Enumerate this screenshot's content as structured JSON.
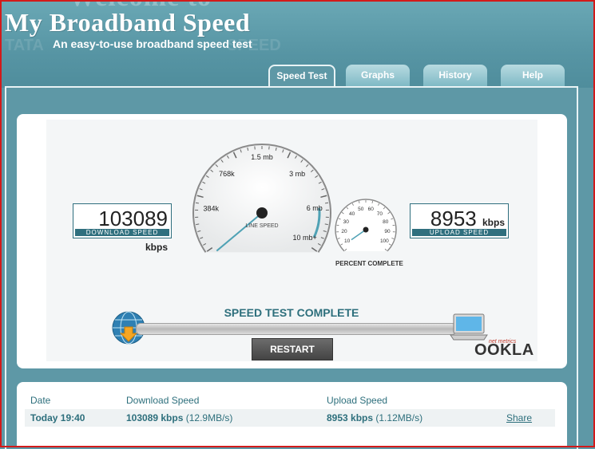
{
  "header": {
    "welcome_text": "Welcome to",
    "site_title": "My Broadband Speed",
    "tagline": "An easy-to-use broadband speed test"
  },
  "tabs": [
    {
      "label": "Speed Test",
      "active": true
    },
    {
      "label": "Graphs",
      "active": false
    },
    {
      "label": "History",
      "active": false
    },
    {
      "label": "Help",
      "active": false
    }
  ],
  "test": {
    "download_value": "103089",
    "download_unit": "kbps",
    "download_caption": "DOWNLOAD SPEED",
    "upload_value": "8953",
    "upload_unit": "kbps",
    "upload_caption": "UPLOAD SPEED",
    "line_gauge": {
      "caption": "LINE SPEED",
      "tick_labels": [
        "384k",
        "768k",
        "1.5 mb",
        "3 mb",
        "6 mb",
        "10 mb+"
      ],
      "needle_fraction": 0.02
    },
    "percent_gauge": {
      "caption": "PERCENT COMPLETE",
      "tick_labels": [
        "10",
        "20",
        "30",
        "40",
        "50",
        "60",
        "70",
        "80",
        "90",
        "100"
      ],
      "needle_fraction": 0.0
    },
    "status": "SPEED TEST COMPLETE",
    "restart_label": "RESTART",
    "brand": "OOKLA",
    "brand_sub": "net metrics"
  },
  "results": {
    "headers": {
      "date": "Date",
      "download": "Download Speed",
      "upload": "Upload Speed"
    },
    "row": {
      "date": "Today 19:40",
      "download": "103089 kbps",
      "download_detail": "(12.9MB/s)",
      "upload": "8953 kbps",
      "upload_detail": "(1.12MB/s)",
      "share": "Share"
    }
  },
  "colors": {
    "accent": "#2d6f7c",
    "background": "#5e98a6"
  }
}
